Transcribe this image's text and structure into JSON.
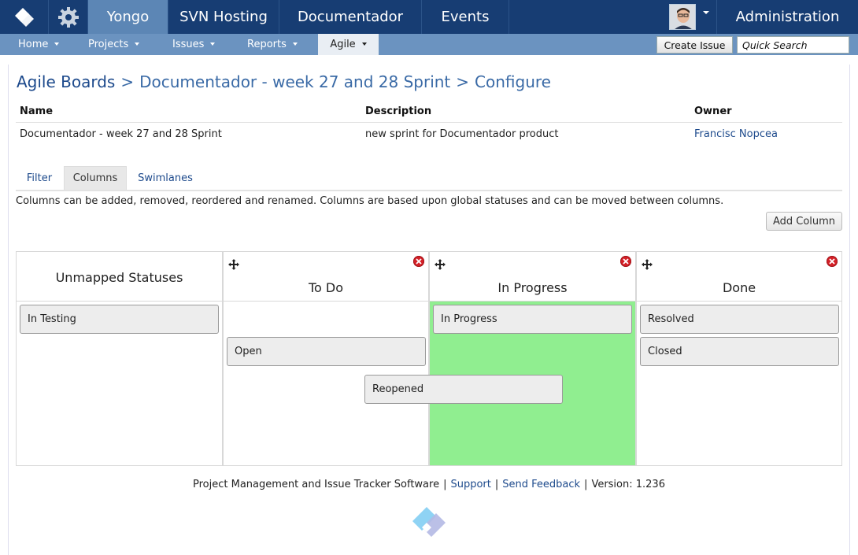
{
  "topbar": {
    "tabs": [
      {
        "label": "Yongo",
        "active": true
      },
      {
        "label": "SVN Hosting",
        "active": false
      },
      {
        "label": "Documentador",
        "active": false
      },
      {
        "label": "Events",
        "active": false
      }
    ],
    "admin_label": "Administration"
  },
  "subnav": {
    "items": [
      {
        "label": "Home"
      },
      {
        "label": "Projects"
      },
      {
        "label": "Issues"
      },
      {
        "label": "Reports"
      },
      {
        "label": "Agile",
        "active": true
      }
    ],
    "create_issue_label": "Create Issue",
    "quick_search_placeholder": "Quick Search"
  },
  "breadcrumb": {
    "root": "Agile Boards",
    "separator": ">",
    "board": "Documentador - week 27 and 28 Sprint",
    "page": "Configure"
  },
  "info": {
    "headers": {
      "name": "Name",
      "description": "Description",
      "owner": "Owner"
    },
    "name": "Documentador - week 27 and 28 Sprint",
    "description": "new sprint for Documentador product",
    "owner": "Francisc Nopcea"
  },
  "tabs": [
    {
      "label": "Filter"
    },
    {
      "label": "Columns",
      "active": true
    },
    {
      "label": "Swimlanes"
    }
  ],
  "columns_description": "Columns can be added, removed, reordered and renamed. Columns are based upon global statuses and can be moved between columns.",
  "add_column_label": "Add Column",
  "board": {
    "unmapped": {
      "title": "Unmapped Statuses",
      "statuses": [
        "In Testing"
      ]
    },
    "columns": [
      {
        "title": "To Do",
        "statuses": [
          "Open"
        ]
      },
      {
        "title": "In Progress",
        "statuses": [
          "In Progress"
        ],
        "highlight_color": "#90ee90"
      },
      {
        "title": "Done",
        "statuses": [
          "Resolved",
          "Closed"
        ]
      }
    ],
    "dragging_status": "Reopened"
  },
  "footer": {
    "text": "Project Management and Issue Tracker Software",
    "separator": "|",
    "support_label": "Support",
    "feedback_label": "Send Feedback",
    "version_label": "Version: 1.236"
  },
  "colors": {
    "topbar": "#173d73",
    "active_tab": "#5c86b5",
    "subnav": "#6b93c0",
    "link": "#1d4a8c",
    "highlight": "#90ee90"
  }
}
